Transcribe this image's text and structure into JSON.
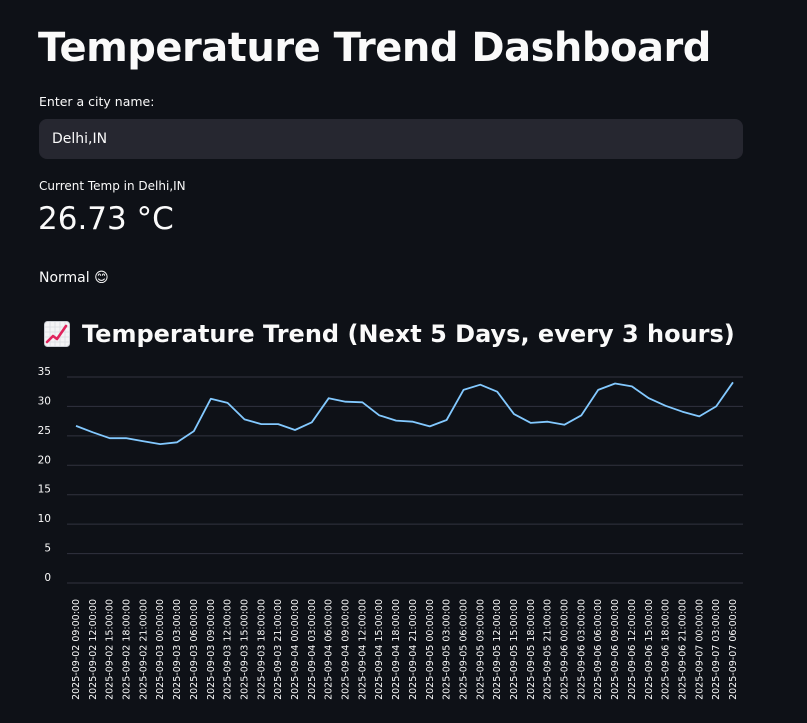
{
  "header": {
    "title": "Temperature Trend Dashboard"
  },
  "city": {
    "label": "Enter a city name:",
    "value": "Delhi,IN"
  },
  "metric": {
    "label": "Current Temp in Delhi,IN",
    "value": "26.73 °C"
  },
  "status": {
    "text": "Normal 😊"
  },
  "trend": {
    "heading": "Temperature Trend (Next 5 Days, every 3 hours)",
    "icon": "chart-increasing-icon"
  },
  "colors": {
    "background": "#0e1117",
    "input_bg": "#262730",
    "line": "#83c9ff",
    "grid": "#31333f",
    "text": "#fafafa"
  },
  "chart_data": {
    "type": "line",
    "x": [
      "2025-09-02 09:00:00",
      "2025-09-02 12:00:00",
      "2025-09-02 15:00:00",
      "2025-09-02 18:00:00",
      "2025-09-02 21:00:00",
      "2025-09-03 00:00:00",
      "2025-09-03 03:00:00",
      "2025-09-03 06:00:00",
      "2025-09-03 09:00:00",
      "2025-09-03 12:00:00",
      "2025-09-03 15:00:00",
      "2025-09-03 18:00:00",
      "2025-09-03 21:00:00",
      "2025-09-04 00:00:00",
      "2025-09-04 03:00:00",
      "2025-09-04 06:00:00",
      "2025-09-04 09:00:00",
      "2025-09-04 12:00:00",
      "2025-09-04 15:00:00",
      "2025-09-04 18:00:00",
      "2025-09-04 21:00:00",
      "2025-09-05 00:00:00",
      "2025-09-05 03:00:00",
      "2025-09-05 06:00:00",
      "2025-09-05 09:00:00",
      "2025-09-05 12:00:00",
      "2025-09-05 15:00:00",
      "2025-09-05 18:00:00",
      "2025-09-05 21:00:00",
      "2025-09-06 00:00:00",
      "2025-09-06 03:00:00",
      "2025-09-06 06:00:00",
      "2025-09-06 09:00:00",
      "2025-09-06 12:00:00",
      "2025-09-06 15:00:00",
      "2025-09-06 18:00:00",
      "2025-09-06 21:00:00",
      "2025-09-07 00:00:00",
      "2025-09-07 03:00:00",
      "2025-09-07 06:00:00"
    ],
    "values": [
      26.7,
      25.6,
      24.6,
      24.6,
      24.1,
      23.6,
      23.9,
      25.8,
      31.3,
      30.6,
      27.8,
      27.0,
      27.0,
      26.0,
      27.3,
      31.4,
      30.8,
      30.7,
      28.5,
      27.6,
      27.4,
      26.6,
      27.7,
      32.8,
      33.7,
      32.5,
      28.7,
      27.2,
      27.4,
      26.9,
      28.5,
      32.8,
      33.9,
      33.4,
      31.4,
      30.1,
      29.1,
      28.3,
      30.0,
      34.1
    ],
    "yticks": [
      0,
      5,
      10,
      15,
      20,
      25,
      30,
      35
    ],
    "ylim": [
      0,
      35
    ],
    "grid": true,
    "color": "#83c9ff"
  }
}
